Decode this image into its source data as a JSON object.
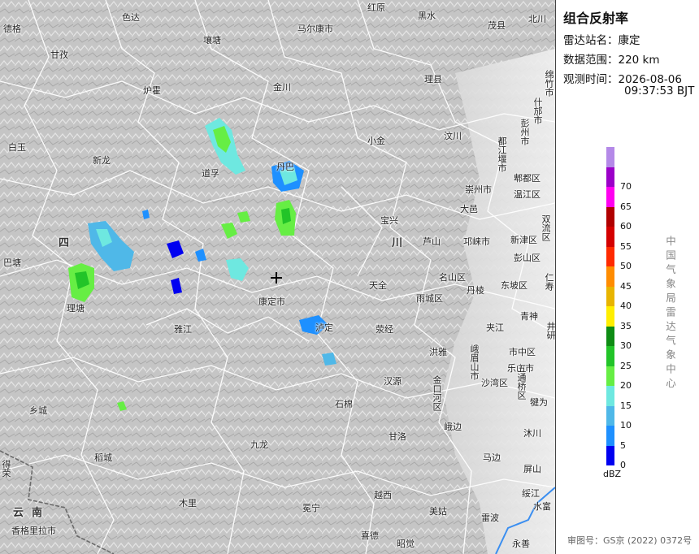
{
  "panel": {
    "title": "组合反射率",
    "station_label": "雷达站名：",
    "station_value": "康定",
    "range_label": "数据范围：",
    "range_value": "220 km",
    "time_label": "观测时间：",
    "time_date": "2026-08-06",
    "time_clock": "09:37:53 BJT",
    "legend_unit": "dBZ",
    "organization": "中国气象局雷达气象中心",
    "review_number": "审图号：GS京 (2022) 0372号"
  },
  "legend": [
    {
      "label": "0",
      "color": "#0000f0"
    },
    {
      "label": "5",
      "color": "#1e90ff"
    },
    {
      "label": "10",
      "color": "#4fb8e8"
    },
    {
      "label": "15",
      "color": "#6ee8e0"
    },
    {
      "label": "20",
      "color": "#66ee44"
    },
    {
      "label": "25",
      "color": "#22c428"
    },
    {
      "label": "30",
      "color": "#0e8c14"
    },
    {
      "label": "35",
      "color": "#ffee00"
    },
    {
      "label": "40",
      "color": "#e8b400"
    },
    {
      "label": "45",
      "color": "#ff8c00"
    },
    {
      "label": "50",
      "color": "#ff2a00"
    },
    {
      "label": "55",
      "color": "#d40000"
    },
    {
      "label": "60",
      "color": "#b00000"
    },
    {
      "label": "65",
      "color": "#ff00f0"
    },
    {
      "label": "70",
      "color": "#9b00c8"
    },
    {
      "label": "",
      "color": "#b489e8"
    }
  ],
  "places": [
    "德格",
    "色达",
    "红原",
    "黑水",
    "茂县",
    "北川",
    "甘孜",
    "壤塘",
    "马尔康市",
    "炉霍",
    "金川",
    "理县",
    "绵竹市",
    "什邡市",
    "彭州市",
    "都江堰市",
    "郫都区",
    "温江区",
    "白玉",
    "新龙",
    "道孚",
    "丹巴",
    "小金",
    "汶川",
    "崇州市",
    "大邑",
    "宝兴",
    "芦山",
    "邛崃市",
    "新津区",
    "双流区",
    "彭山区",
    "巴塘",
    "四",
    "川",
    "理塘",
    "康定市",
    "天全",
    "雨城区",
    "名山区",
    "丹棱",
    "东坡区",
    "仁寿",
    "青神",
    "雅江",
    "泸定",
    "荥经",
    "洪雅",
    "夹江",
    "市中区",
    "井研",
    "乐山市",
    "五通桥区",
    "沙湾区",
    "犍为",
    "汉源",
    "金口河区",
    "峨眉山市",
    "乡城",
    "石棉",
    "峨边",
    "沐川",
    "九龙",
    "甘洛",
    "马边",
    "稻城",
    "屏山",
    "得荣",
    "云南",
    "香格里拉市",
    "木里",
    "冕宁",
    "越西",
    "美姑",
    "雷波",
    "绥江",
    "水富",
    "喜德",
    "昭觉",
    "永善"
  ]
}
